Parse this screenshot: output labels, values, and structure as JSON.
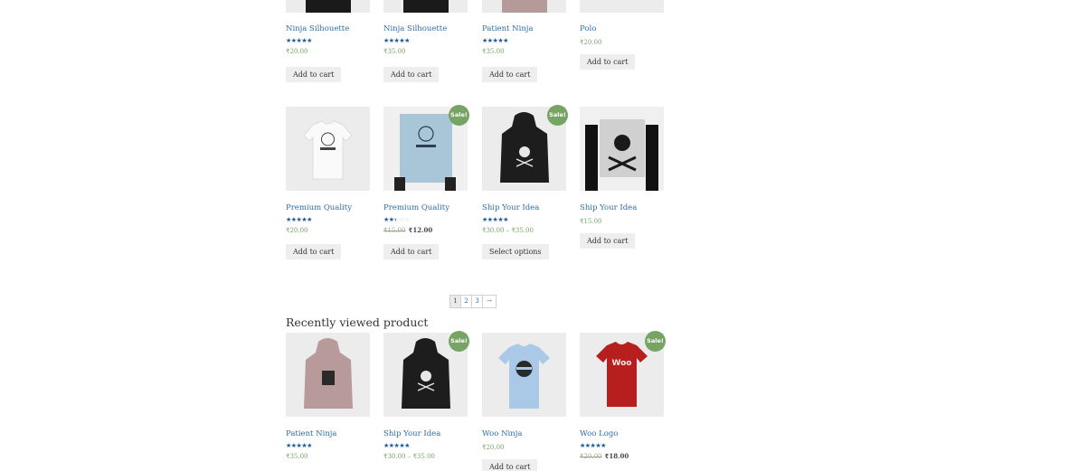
{
  "row1": [
    {
      "title": "Ninja Silhouette",
      "rating": 5,
      "price": "₹20.00",
      "button": "Add to cart"
    },
    {
      "title": "Ninja Silhouette",
      "rating": 4,
      "price": "₹35.00",
      "button": "Add to cart"
    },
    {
      "title": "Patient Ninja",
      "rating": 5,
      "price": "₹35.00",
      "button": "Add to cart"
    },
    {
      "title": "Polo",
      "price": "₹20.00",
      "button": "Add to cart"
    }
  ],
  "row2": [
    {
      "title": "Premium Quality",
      "rating": 4.5,
      "price": "₹20.00",
      "button": "Add to cart"
    },
    {
      "title": "Premium Quality",
      "sale": "Sale!",
      "rating": 2,
      "price_old": "₹15.00",
      "price": "₹12.00",
      "button": "Add to cart"
    },
    {
      "title": "Ship Your Idea",
      "sale": "Sale!",
      "rating": 4,
      "price": "₹30.00 – ₹35.00",
      "button": "Select options"
    },
    {
      "title": "Ship Your Idea",
      "price": "₹15.00",
      "button": "Add to cart"
    }
  ],
  "pagination": {
    "pages": [
      "1",
      "2",
      "3"
    ],
    "next": "→",
    "current": 1
  },
  "recent": {
    "heading": "Recently viewed product",
    "items": [
      {
        "title": "Patient Ninja",
        "rating": 5,
        "price": "₹35.00"
      },
      {
        "title": "Ship Your Idea",
        "sale": "Sale!",
        "rating": 4,
        "price": "₹30.00 – ₹35.00"
      },
      {
        "title": "Woo Ninja",
        "price": "₹20.00",
        "button": "Add to cart"
      },
      {
        "title": "Woo Logo",
        "sale": "Sale!",
        "rating": 4,
        "price_old": "₹20.00",
        "price": "₹18.00"
      }
    ]
  },
  "star_glyphs": {
    "filled": "★★★★★",
    "empty": "☆☆☆☆☆"
  },
  "logo_text": "Woo",
  "colors": {
    "link": "#2c6ea6",
    "sale_badge": "#77a464",
    "star": "#1f5d9c",
    "price": "#77a464",
    "button_bg": "#eeeeee"
  }
}
